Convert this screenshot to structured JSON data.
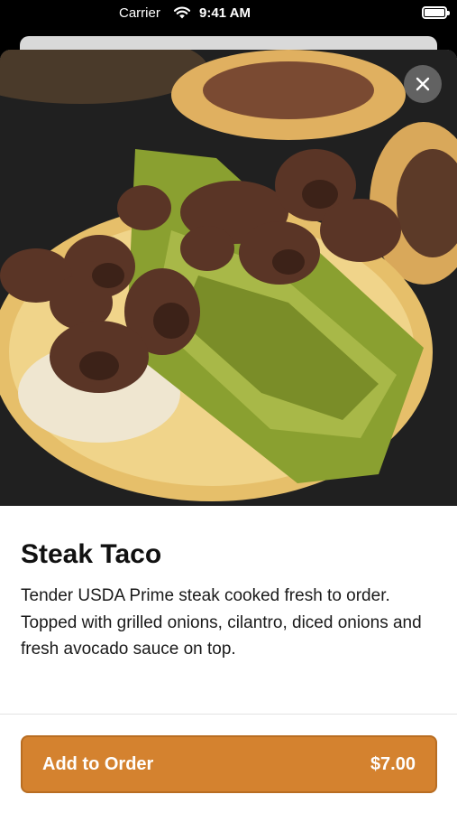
{
  "status_bar": {
    "carrier": "Carrier",
    "time": "9:41 AM",
    "wifi_icon": "wifi-icon",
    "battery_icon": "battery-icon"
  },
  "item": {
    "image_icon": "food-photo",
    "close_icon": "close-icon",
    "title": "Steak Taco",
    "description": "Tender USDA Prime steak cooked fresh to order. Topped with grilled onions, cilantro, diced onions and fresh avocado sauce on top."
  },
  "action": {
    "add_label": "Add to Order",
    "price": "$7.00"
  },
  "colors": {
    "accent": "#d4822f",
    "accent_border": "#b86d22",
    "background": "#ffffff"
  }
}
